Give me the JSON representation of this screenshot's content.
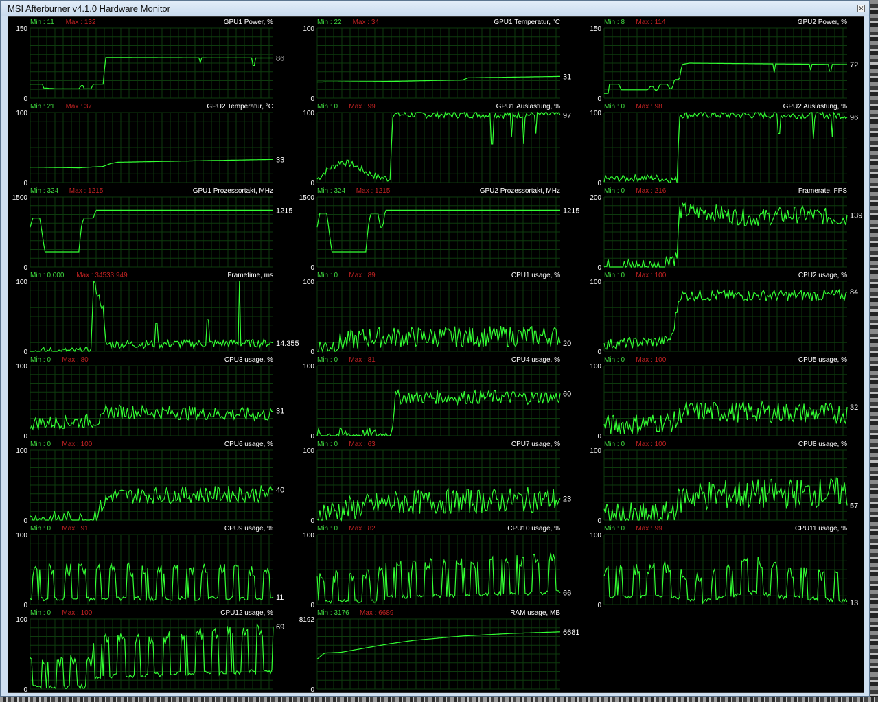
{
  "window": {
    "title": "MSI Afterburner v4.1.0 Hardware Monitor",
    "close_icon": "close-icon"
  },
  "graphs": [
    {
      "title": "GPU1 Power, %",
      "min_label": "Min : 11",
      "max_label": "Max : 132",
      "axis_top": "150",
      "axis_bottom": "0",
      "scale_max": 150,
      "value": "86",
      "shape": "step",
      "pts": [
        [
          0,
          30
        ],
        [
          0.05,
          30
        ],
        [
          0.05,
          22
        ],
        [
          0.11,
          20
        ],
        [
          0.2,
          20
        ],
        [
          0.21,
          27
        ],
        [
          0.22,
          27
        ],
        [
          0.22,
          20
        ],
        [
          0.25,
          20
        ],
        [
          0.26,
          30
        ],
        [
          0.3,
          30
        ],
        [
          0.31,
          87
        ],
        [
          1,
          86
        ]
      ],
      "dips": [
        [
          0.7,
          76
        ],
        [
          0.92,
          70
        ]
      ]
    },
    {
      "title": "GPU1 Temperatur, °C",
      "min_label": "Min : 22",
      "max_label": "Max : 34",
      "axis_top": "100",
      "axis_bottom": "0",
      "scale_max": 100,
      "value": "31",
      "shape": "step",
      "pts": [
        [
          0,
          23
        ],
        [
          0.3,
          24
        ],
        [
          0.31,
          24
        ],
        [
          0.6,
          26
        ],
        [
          0.62,
          29
        ],
        [
          1,
          31
        ]
      ]
    },
    {
      "title": "GPU2 Power, %",
      "min_label": "Min : 8",
      "max_label": "Max : 114",
      "axis_top": "150",
      "axis_bottom": "0",
      "scale_max": 150,
      "value": "72",
      "shape": "step",
      "pts": [
        [
          0,
          10
        ],
        [
          0.02,
          10
        ],
        [
          0.02,
          30
        ],
        [
          0.06,
          30
        ],
        [
          0.07,
          18
        ],
        [
          0.18,
          18
        ],
        [
          0.19,
          25
        ],
        [
          0.2,
          25
        ],
        [
          0.21,
          17
        ],
        [
          0.22,
          17
        ],
        [
          0.23,
          30
        ],
        [
          0.26,
          30
        ],
        [
          0.27,
          20
        ],
        [
          0.28,
          20
        ],
        [
          0.29,
          40
        ],
        [
          0.31,
          40
        ],
        [
          0.32,
          72
        ],
        [
          0.35,
          75
        ],
        [
          1,
          72
        ]
      ],
      "dips": [
        [
          0.7,
          55
        ],
        [
          0.85,
          60
        ],
        [
          0.93,
          58
        ]
      ]
    },
    {
      "title": "GPU2 Temperatur, °C",
      "min_label": "Min : 21",
      "max_label": "Max : 37",
      "axis_top": "100",
      "axis_bottom": "0",
      "scale_max": 100,
      "value": "33",
      "shape": "step",
      "pts": [
        [
          0,
          22
        ],
        [
          0.2,
          21
        ],
        [
          0.3,
          23
        ],
        [
          0.33,
          27
        ],
        [
          0.36,
          29
        ],
        [
          1,
          33
        ]
      ]
    },
    {
      "title": "GPU1 Auslastung, %",
      "min_label": "Min : 0",
      "max_label": "Max : 99",
      "axis_top": "100",
      "axis_bottom": "0",
      "scale_max": 100,
      "value": "97",
      "shape": "noisy",
      "pts": [
        [
          0,
          5
        ],
        [
          0.05,
          20
        ],
        [
          0.1,
          30
        ],
        [
          0.15,
          25
        ],
        [
          0.2,
          15
        ],
        [
          0.25,
          8
        ],
        [
          0.3,
          5
        ],
        [
          0.31,
          97
        ],
        [
          1,
          97
        ]
      ],
      "noise": 5,
      "dips": [
        [
          0.72,
          55
        ],
        [
          0.8,
          65
        ],
        [
          0.85,
          55
        ],
        [
          0.9,
          70
        ]
      ]
    },
    {
      "title": "GPU2 Auslastung, %",
      "min_label": "Min : 0",
      "max_label": "Max : 98",
      "axis_top": "100",
      "axis_bottom": "0",
      "scale_max": 100,
      "value": "96",
      "shape": "noisy",
      "pts": [
        [
          0,
          5
        ],
        [
          0.2,
          7
        ],
        [
          0.3,
          3
        ],
        [
          0.31,
          97
        ],
        [
          1,
          96
        ]
      ],
      "noise": 5,
      "dips": [
        [
          0.72,
          70
        ],
        [
          0.86,
          62
        ],
        [
          0.94,
          65
        ]
      ]
    },
    {
      "title": "GPU1 Prozessortakt, MHz",
      "min_label": "Min : 324",
      "max_label": "Max : 1215",
      "axis_top": "1500",
      "axis_bottom": "0",
      "scale_max": 1500,
      "value": "1215",
      "shape": "step",
      "pts": [
        [
          0,
          850
        ],
        [
          0.01,
          1050
        ],
        [
          0.04,
          1050
        ],
        [
          0.06,
          324
        ],
        [
          0.2,
          324
        ],
        [
          0.21,
          850
        ],
        [
          0.22,
          1050
        ],
        [
          0.26,
          1050
        ],
        [
          0.27,
          1215
        ],
        [
          0.31,
          1215
        ],
        [
          0.32,
          1215
        ],
        [
          1,
          1215
        ]
      ]
    },
    {
      "title": "GPU2 Prozessortakt, MHz",
      "min_label": "Min : 324",
      "max_label": "Max : 1215",
      "axis_top": "1500",
      "axis_bottom": "0",
      "scale_max": 1500,
      "value": "1215",
      "shape": "step",
      "pts": [
        [
          0,
          850
        ],
        [
          0.01,
          1150
        ],
        [
          0.04,
          1150
        ],
        [
          0.06,
          324
        ],
        [
          0.2,
          324
        ],
        [
          0.21,
          850
        ],
        [
          0.22,
          1150
        ],
        [
          0.25,
          1150
        ],
        [
          0.26,
          850
        ],
        [
          0.27,
          850
        ],
        [
          0.28,
          1215
        ],
        [
          1,
          1215
        ]
      ]
    },
    {
      "title": "Framerate, FPS",
      "min_label": "Min : 0",
      "max_label": "Max : 216",
      "axis_top": "200",
      "axis_bottom": "0",
      "scale_max": 200,
      "value": "139",
      "shape": "noisy",
      "pts": [
        [
          0,
          0
        ],
        [
          0.25,
          2
        ],
        [
          0.26,
          28
        ],
        [
          0.3,
          28
        ],
        [
          0.31,
          160
        ],
        [
          0.45,
          155
        ],
        [
          0.6,
          140
        ],
        [
          0.8,
          150
        ],
        [
          1,
          139
        ]
      ],
      "noise": 25
    },
    {
      "title": "Frametime, ms",
      "min_label": "Min : 0.000",
      "max_label": "Max : 34533.949",
      "axis_top": "100",
      "axis_bottom": "0",
      "scale_max": 100,
      "value": "14.355",
      "shape": "noisy",
      "pts": [
        [
          0,
          0
        ],
        [
          0.25,
          0
        ],
        [
          0.26,
          100
        ],
        [
          0.3,
          60
        ],
        [
          0.31,
          10
        ],
        [
          1,
          12
        ]
      ],
      "noise": 6,
      "spikes": [
        [
          0.52,
          40
        ],
        [
          0.73,
          45
        ],
        [
          0.86,
          100
        ]
      ]
    },
    {
      "title": "CPU1 usage, %",
      "min_label": "Min : 0",
      "max_label": "Max : 89",
      "axis_top": "100",
      "axis_bottom": "0",
      "scale_max": 100,
      "value": "20",
      "shape": "noisy",
      "pts": [
        [
          0,
          5
        ],
        [
          0.2,
          20
        ],
        [
          1,
          22
        ]
      ],
      "noise": 15
    },
    {
      "title": "CPU2 usage, %",
      "min_label": "Min : 0",
      "max_label": "Max : 100",
      "axis_top": "100",
      "axis_bottom": "0",
      "scale_max": 100,
      "value": "84",
      "shape": "noisy",
      "pts": [
        [
          0,
          10
        ],
        [
          0.25,
          15
        ],
        [
          0.28,
          20
        ],
        [
          0.31,
          80
        ],
        [
          1,
          80
        ]
      ],
      "noise": 8
    },
    {
      "title": "CPU3 usage, %",
      "min_label": "Min : 0",
      "max_label": "Max : 80",
      "axis_top": "100",
      "axis_bottom": "0",
      "scale_max": 100,
      "value": "31",
      "shape": "noisy",
      "pts": [
        [
          0,
          18
        ],
        [
          0.3,
          22
        ],
        [
          0.31,
          35
        ],
        [
          1,
          30
        ]
      ],
      "noise": 10
    },
    {
      "title": "CPU4 usage, %",
      "min_label": "Min : 0",
      "max_label": "Max : 81",
      "axis_top": "100",
      "axis_bottom": "0",
      "scale_max": 100,
      "value": "60",
      "shape": "noisy",
      "pts": [
        [
          0,
          1
        ],
        [
          0.3,
          1
        ],
        [
          0.31,
          15
        ],
        [
          0.32,
          55
        ],
        [
          1,
          55
        ]
      ],
      "noise": 10
    },
    {
      "title": "CPU5 usage, %",
      "min_label": "Min : 0",
      "max_label": "Max : 100",
      "axis_top": "100",
      "axis_bottom": "0",
      "scale_max": 100,
      "value": "32",
      "shape": "noisy",
      "pts": [
        [
          0,
          15
        ],
        [
          0.3,
          20
        ],
        [
          0.32,
          35
        ],
        [
          1,
          32
        ]
      ],
      "noise": 15
    },
    {
      "title": "CPU6 usage, %",
      "min_label": "Min : 0",
      "max_label": "Max : 100",
      "axis_top": "100",
      "axis_bottom": "0",
      "scale_max": 100,
      "value": "40",
      "shape": "noisy",
      "pts": [
        [
          0,
          1
        ],
        [
          0.25,
          1
        ],
        [
          0.27,
          10
        ],
        [
          0.33,
          35
        ],
        [
          1,
          38
        ]
      ],
      "noise": 12
    },
    {
      "title": "CPU7 usage, %",
      "min_label": "Min : 0",
      "max_label": "Max : 63",
      "axis_top": "100",
      "axis_bottom": "0",
      "scale_max": 100,
      "value": "23",
      "shape": "noisy",
      "pts": [
        [
          0,
          10
        ],
        [
          0.3,
          25
        ],
        [
          1,
          30
        ]
      ],
      "noise": 18
    },
    {
      "title": "CPU8 usage, %",
      "min_label": "Min : 0",
      "max_label": "Max : 100",
      "axis_top": "100",
      "axis_bottom": "0",
      "scale_max": 100,
      "value": "57",
      "shape": "noisy",
      "pts": [
        [
          0,
          3
        ],
        [
          0.25,
          3
        ],
        [
          0.27,
          10
        ],
        [
          0.33,
          35
        ],
        [
          1,
          40
        ]
      ],
      "noise": 22
    },
    {
      "title": "CPU9 usage, %",
      "min_label": "Min : 0",
      "max_label": "Max : 91",
      "axis_top": "100",
      "axis_bottom": "0",
      "scale_max": 100,
      "value": "11",
      "shape": "square",
      "pts": [
        [
          0,
          10
        ],
        [
          1,
          12
        ]
      ],
      "noise": 35
    },
    {
      "title": "CPU10 usage, %",
      "min_label": "Min : 0",
      "max_label": "Max : 82",
      "axis_top": "100",
      "axis_bottom": "0",
      "scale_max": 100,
      "value": "66",
      "shape": "square",
      "pts": [
        [
          0,
          2
        ],
        [
          0.25,
          3
        ],
        [
          0.3,
          15
        ],
        [
          1,
          30
        ]
      ],
      "noise": 35
    },
    {
      "title": "CPU11 usage, %",
      "min_label": "Min : 0",
      "max_label": "Max : 99",
      "axis_top": "100",
      "axis_bottom": "0",
      "scale_max": 100,
      "value": "13",
      "shape": "square",
      "pts": [
        [
          0,
          15
        ],
        [
          0.25,
          20
        ],
        [
          0.4,
          2
        ],
        [
          0.6,
          30
        ],
        [
          0.75,
          15
        ],
        [
          1,
          5
        ]
      ],
      "noise": 30
    },
    {
      "title": "CPU12 usage, %",
      "min_label": "Min : 0",
      "max_label": "Max : 100",
      "axis_top": "100",
      "axis_bottom": "0",
      "scale_max": 100,
      "value": "69",
      "shape": "square",
      "pts": [
        [
          0,
          1
        ],
        [
          0.25,
          1
        ],
        [
          0.27,
          30
        ],
        [
          1,
          45
        ]
      ],
      "noise": 35
    },
    {
      "title": "RAM usage, MB",
      "min_label": "Min : 3176",
      "max_label": "Max : 6689",
      "axis_top": "8192",
      "axis_bottom": "0",
      "scale_max": 8192,
      "value": "6681",
      "shape": "step",
      "pts": [
        [
          0,
          3500
        ],
        [
          0.03,
          4200
        ],
        [
          0.1,
          4300
        ],
        [
          0.2,
          4800
        ],
        [
          0.3,
          5300
        ],
        [
          0.4,
          5700
        ],
        [
          0.5,
          5950
        ],
        [
          0.6,
          6200
        ],
        [
          0.8,
          6500
        ],
        [
          1,
          6681
        ]
      ]
    }
  ]
}
